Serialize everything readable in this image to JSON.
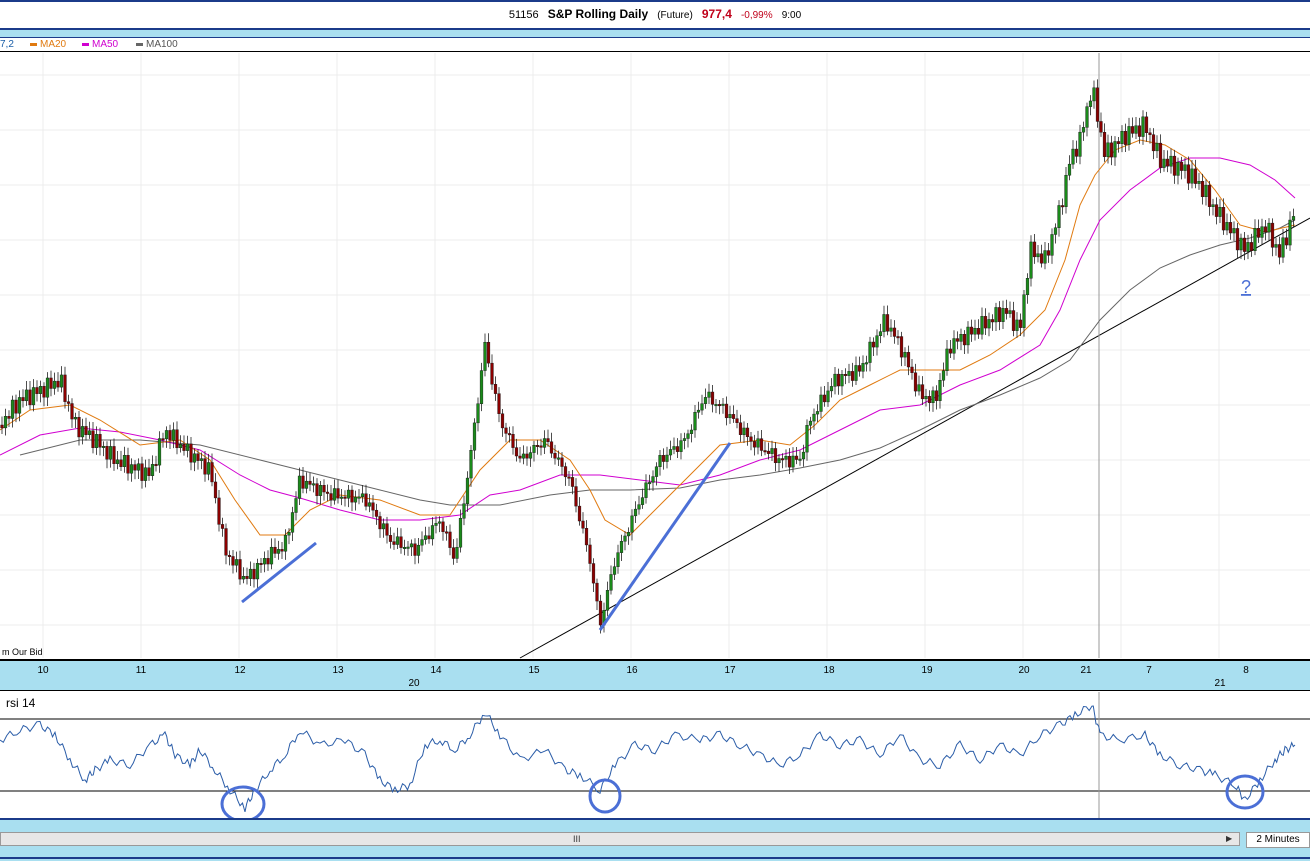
{
  "header": {
    "code": "51156",
    "title": "S&P Rolling Daily",
    "type": "(Future)",
    "price": "977,4",
    "change": "-0,99%",
    "time": "9:00"
  },
  "legend": {
    "first_partial": "7,2",
    "items": [
      {
        "label": "MA20",
        "color": "#e07a10"
      },
      {
        "label": "MA50",
        "color": "#d000d0"
      },
      {
        "label": "MA100",
        "color": "#666666"
      }
    ]
  },
  "chart_corner_text": "m Our Bid",
  "question_mark": "?",
  "x_axis": {
    "day_labels": [
      "10",
      "11",
      "12",
      "13",
      "14",
      "15",
      "16",
      "17",
      "18",
      "19",
      "20",
      "21",
      "7",
      "8"
    ],
    "month_labels": [
      "20",
      "21"
    ]
  },
  "rsi_panel": {
    "label": "rsi 14"
  },
  "bottom": {
    "interval": "2 Minutes",
    "scroll_grip": "III",
    "scroll_arrow": "▶"
  },
  "chart_data": {
    "type": "line",
    "price_path": [
      [
        0,
        425
      ],
      [
        20,
        400
      ],
      [
        45,
        388
      ],
      [
        60,
        380
      ],
      [
        75,
        425
      ],
      [
        95,
        440
      ],
      [
        115,
        460
      ],
      [
        150,
        475
      ],
      [
        165,
        430
      ],
      [
        180,
        445
      ],
      [
        210,
        470
      ],
      [
        225,
        550
      ],
      [
        245,
        580
      ],
      [
        270,
        555
      ],
      [
        285,
        545
      ],
      [
        300,
        480
      ],
      [
        330,
        495
      ],
      [
        365,
        498
      ],
      [
        390,
        540
      ],
      [
        415,
        550
      ],
      [
        440,
        520
      ],
      [
        455,
        560
      ],
      [
        470,
        460
      ],
      [
        485,
        345
      ],
      [
        500,
        420
      ],
      [
        520,
        460
      ],
      [
        545,
        440
      ],
      [
        570,
        480
      ],
      [
        580,
        520
      ],
      [
        590,
        560
      ],
      [
        600,
        625
      ],
      [
        615,
        560
      ],
      [
        640,
        500
      ],
      [
        660,
        460
      ],
      [
        685,
        440
      ],
      [
        705,
        395
      ],
      [
        725,
        410
      ],
      [
        750,
        440
      ],
      [
        780,
        460
      ],
      [
        800,
        460
      ],
      [
        810,
        420
      ],
      [
        835,
        380
      ],
      [
        860,
        370
      ],
      [
        885,
        320
      ],
      [
        900,
        345
      ],
      [
        920,
        395
      ],
      [
        935,
        400
      ],
      [
        950,
        345
      ],
      [
        975,
        330
      ],
      [
        990,
        320
      ],
      [
        1005,
        310
      ],
      [
        1020,
        330
      ],
      [
        1030,
        250
      ],
      [
        1045,
        260
      ],
      [
        1060,
        210
      ],
      [
        1070,
        160
      ],
      [
        1080,
        140
      ],
      [
        1092,
        87
      ],
      [
        1105,
        155
      ],
      [
        1125,
        135
      ],
      [
        1145,
        125
      ],
      [
        1160,
        160
      ],
      [
        1185,
        170
      ],
      [
        1200,
        185
      ],
      [
        1215,
        210
      ],
      [
        1230,
        230
      ],
      [
        1245,
        250
      ],
      [
        1265,
        225
      ],
      [
        1280,
        255
      ],
      [
        1295,
        210
      ]
    ],
    "ma20": [
      [
        0,
        430
      ],
      [
        30,
        410
      ],
      [
        70,
        405
      ],
      [
        100,
        420
      ],
      [
        140,
        445
      ],
      [
        180,
        440
      ],
      [
        210,
        460
      ],
      [
        235,
        500
      ],
      [
        260,
        535
      ],
      [
        285,
        535
      ],
      [
        310,
        510
      ],
      [
        340,
        495
      ],
      [
        380,
        500
      ],
      [
        420,
        515
      ],
      [
        450,
        515
      ],
      [
        480,
        470
      ],
      [
        510,
        440
      ],
      [
        540,
        440
      ],
      [
        570,
        460
      ],
      [
        590,
        490
      ],
      [
        605,
        520
      ],
      [
        630,
        535
      ],
      [
        660,
        505
      ],
      [
        690,
        475
      ],
      [
        720,
        445
      ],
      [
        760,
        440
      ],
      [
        790,
        445
      ],
      [
        815,
        425
      ],
      [
        840,
        400
      ],
      [
        870,
        385
      ],
      [
        900,
        370
      ],
      [
        930,
        370
      ],
      [
        960,
        370
      ],
      [
        990,
        355
      ],
      [
        1020,
        335
      ],
      [
        1045,
        310
      ],
      [
        1065,
        260
      ],
      [
        1080,
        205
      ],
      [
        1095,
        175
      ],
      [
        1115,
        150
      ],
      [
        1140,
        140
      ],
      [
        1165,
        145
      ],
      [
        1190,
        160
      ],
      [
        1215,
        190
      ],
      [
        1240,
        225
      ],
      [
        1265,
        232
      ],
      [
        1295,
        225
      ]
    ],
    "ma50": [
      [
        0,
        455
      ],
      [
        40,
        435
      ],
      [
        80,
        428
      ],
      [
        120,
        432
      ],
      [
        160,
        440
      ],
      [
        200,
        450
      ],
      [
        240,
        475
      ],
      [
        270,
        490
      ],
      [
        300,
        498
      ],
      [
        340,
        510
      ],
      [
        380,
        520
      ],
      [
        420,
        520
      ],
      [
        460,
        515
      ],
      [
        490,
        495
      ],
      [
        520,
        490
      ],
      [
        560,
        475
      ],
      [
        600,
        475
      ],
      [
        640,
        480
      ],
      [
        680,
        485
      ],
      [
        720,
        475
      ],
      [
        760,
        460
      ],
      [
        800,
        450
      ],
      [
        840,
        430
      ],
      [
        880,
        410
      ],
      [
        920,
        405
      ],
      [
        960,
        385
      ],
      [
        1000,
        370
      ],
      [
        1040,
        345
      ],
      [
        1060,
        310
      ],
      [
        1080,
        260
      ],
      [
        1100,
        220
      ],
      [
        1130,
        190
      ],
      [
        1160,
        168
      ],
      [
        1190,
        158
      ],
      [
        1220,
        158
      ],
      [
        1250,
        165
      ],
      [
        1275,
        180
      ],
      [
        1295,
        198
      ]
    ],
    "ma100": [
      [
        20,
        455
      ],
      [
        80,
        440
      ],
      [
        140,
        440
      ],
      [
        200,
        445
      ],
      [
        260,
        460
      ],
      [
        320,
        475
      ],
      [
        380,
        490
      ],
      [
        420,
        500
      ],
      [
        450,
        505
      ],
      [
        500,
        505
      ],
      [
        550,
        495
      ],
      [
        590,
        490
      ],
      [
        630,
        490
      ],
      [
        680,
        488
      ],
      [
        720,
        480
      ],
      [
        760,
        475
      ],
      [
        800,
        468
      ],
      [
        840,
        460
      ],
      [
        880,
        448
      ],
      [
        920,
        430
      ],
      [
        960,
        410
      ],
      [
        1000,
        395
      ],
      [
        1040,
        378
      ],
      [
        1070,
        360
      ],
      [
        1100,
        320
      ],
      [
        1130,
        290
      ],
      [
        1160,
        268
      ],
      [
        1190,
        255
      ],
      [
        1220,
        245
      ],
      [
        1250,
        238
      ],
      [
        1280,
        228
      ],
      [
        1295,
        220
      ]
    ],
    "rsi": [
      [
        0,
        740
      ],
      [
        20,
        730
      ],
      [
        40,
        725
      ],
      [
        55,
        735
      ],
      [
        70,
        760
      ],
      [
        85,
        780
      ],
      [
        95,
        770
      ],
      [
        110,
        760
      ],
      [
        130,
        765
      ],
      [
        150,
        745
      ],
      [
        165,
        735
      ],
      [
        175,
        755
      ],
      [
        190,
        765
      ],
      [
        200,
        750
      ],
      [
        215,
        770
      ],
      [
        230,
        790
      ],
      [
        245,
        808
      ],
      [
        255,
        790
      ],
      [
        270,
        770
      ],
      [
        285,
        755
      ],
      [
        300,
        730
      ],
      [
        320,
        745
      ],
      [
        345,
        740
      ],
      [
        365,
        755
      ],
      [
        380,
        780
      ],
      [
        395,
        790
      ],
      [
        410,
        785
      ],
      [
        425,
        745
      ],
      [
        440,
        740
      ],
      [
        455,
        750
      ],
      [
        470,
        735
      ],
      [
        485,
        712
      ],
      [
        500,
        735
      ],
      [
        520,
        760
      ],
      [
        545,
        750
      ],
      [
        565,
        770
      ],
      [
        580,
        775
      ],
      [
        600,
        790
      ],
      [
        615,
        765
      ],
      [
        635,
        745
      ],
      [
        655,
        750
      ],
      [
        675,
        735
      ],
      [
        700,
        740
      ],
      [
        720,
        735
      ],
      [
        740,
        745
      ],
      [
        760,
        755
      ],
      [
        780,
        765
      ],
      [
        800,
        755
      ],
      [
        820,
        735
      ],
      [
        840,
        745
      ],
      [
        860,
        740
      ],
      [
        880,
        755
      ],
      [
        900,
        735
      ],
      [
        920,
        760
      ],
      [
        940,
        765
      ],
      [
        960,
        745
      ],
      [
        980,
        760
      ],
      [
        1000,
        745
      ],
      [
        1020,
        755
      ],
      [
        1040,
        735
      ],
      [
        1060,
        725
      ],
      [
        1075,
        715
      ],
      [
        1092,
        705
      ],
      [
        1100,
        735
      ],
      [
        1120,
        740
      ],
      [
        1145,
        735
      ],
      [
        1160,
        755
      ],
      [
        1180,
        765
      ],
      [
        1200,
        770
      ],
      [
        1215,
        775
      ],
      [
        1235,
        785
      ],
      [
        1245,
        800
      ],
      [
        1260,
        780
      ],
      [
        1275,
        760
      ],
      [
        1285,
        750
      ],
      [
        1295,
        745
      ]
    ]
  }
}
